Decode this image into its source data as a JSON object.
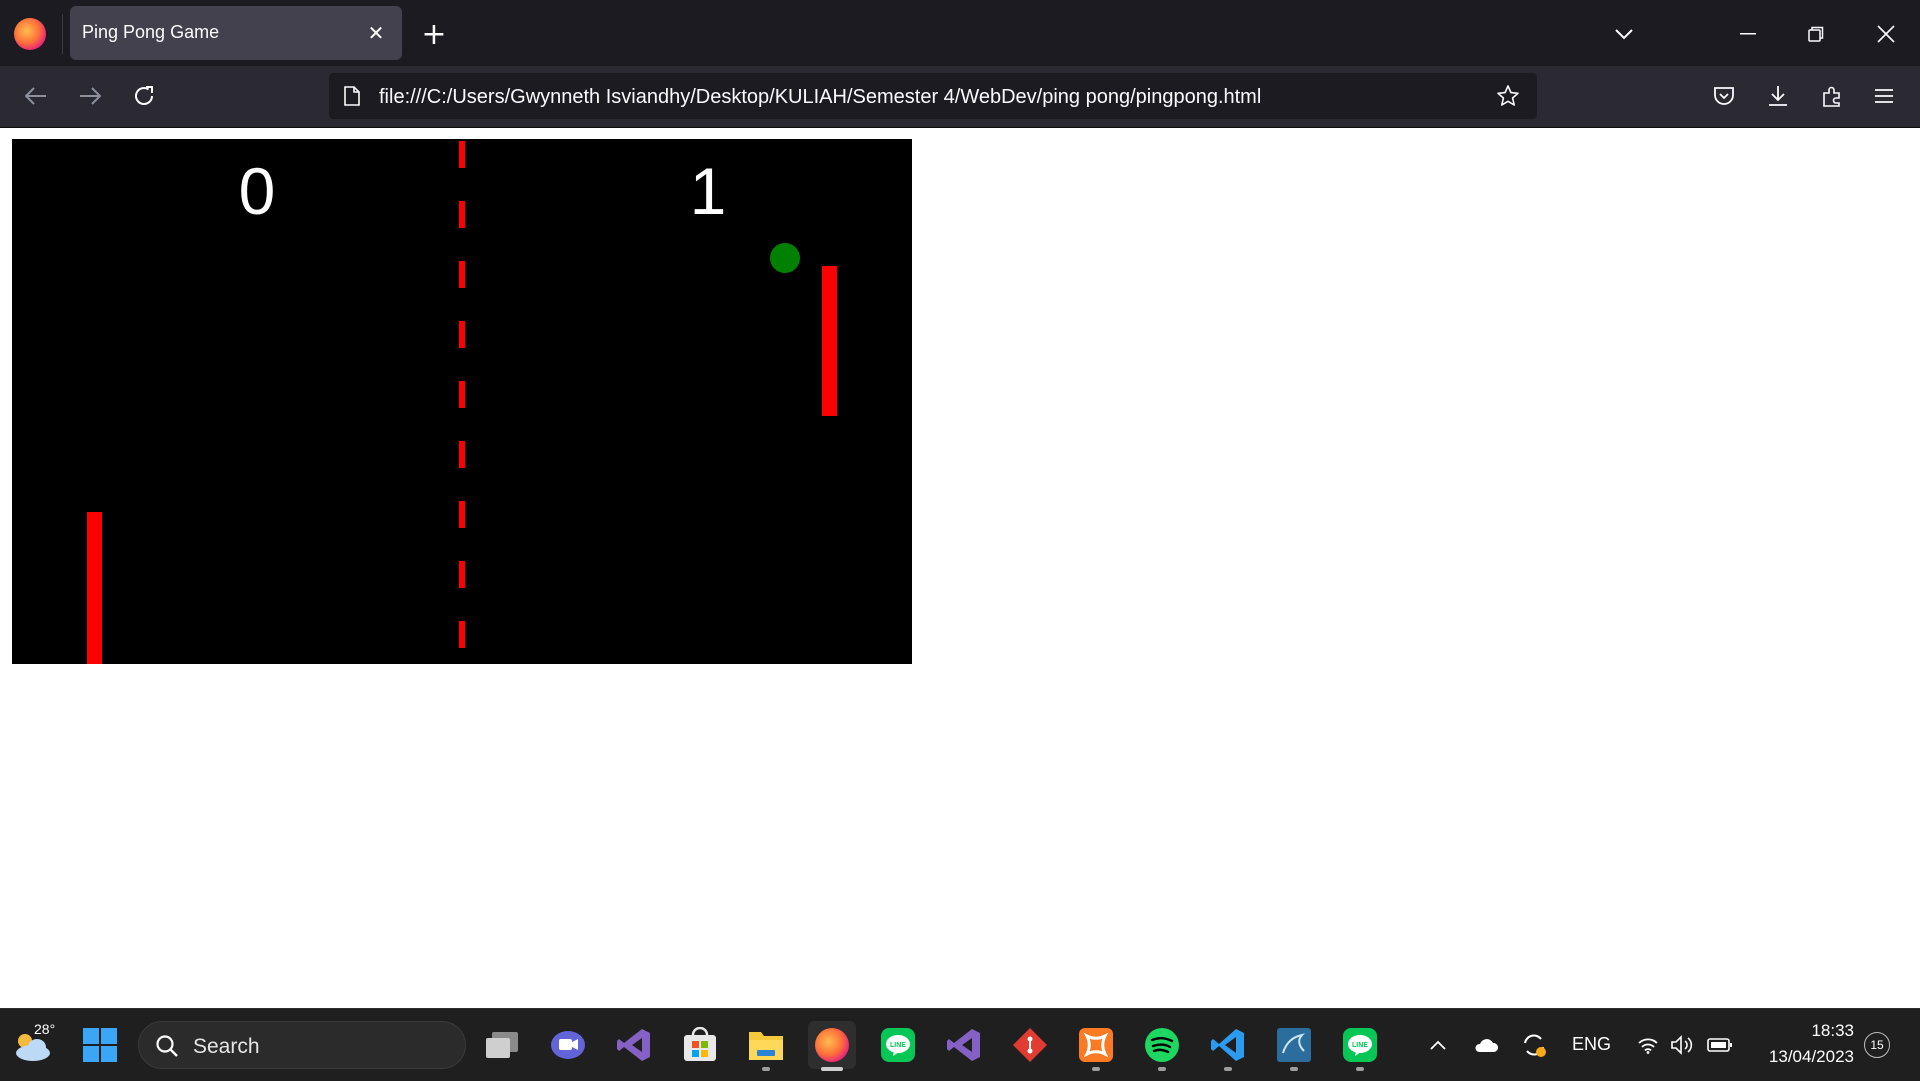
{
  "browser": {
    "tab_title": "Ping Pong Game",
    "tab_close": "✕",
    "new_tab": "+",
    "url": "file:///C:/Users/Gwynneth Isviandhy/Desktop/KULIAH/Semester 4/WebDev/ping pong/pingpong.html",
    "icons": [
      "firefox-icon",
      "chevron-down-icon",
      "minimize-icon",
      "restore-icon",
      "close-icon",
      "back-icon",
      "forward-icon",
      "reload-icon",
      "page-icon",
      "bookmark-star-icon",
      "pocket-icon",
      "download-icon",
      "extensions-icon",
      "menu-icon"
    ]
  },
  "game": {
    "score_left": "0",
    "score_right": "1",
    "colors": {
      "background": "#000000",
      "paddle": "#ff0000",
      "ball": "#008000",
      "net": "#ff0000",
      "score": "#ffffff"
    }
  },
  "taskbar": {
    "weather_temp": "28°",
    "search_label": "Search",
    "apps": [
      "task-view-icon",
      "teams-icon",
      "visual-studio-icon",
      "microsoft-store-icon",
      "file-explorer-icon",
      "firefox-icon",
      "line-icon",
      "visual-studio-icon",
      "git-icon",
      "xampp-icon",
      "spotify-icon",
      "vscode-icon",
      "mysql-workbench-icon",
      "line-icon"
    ],
    "language": "ENG",
    "time": "18:33",
    "date": "13/04/2023",
    "notification_count": "15"
  }
}
